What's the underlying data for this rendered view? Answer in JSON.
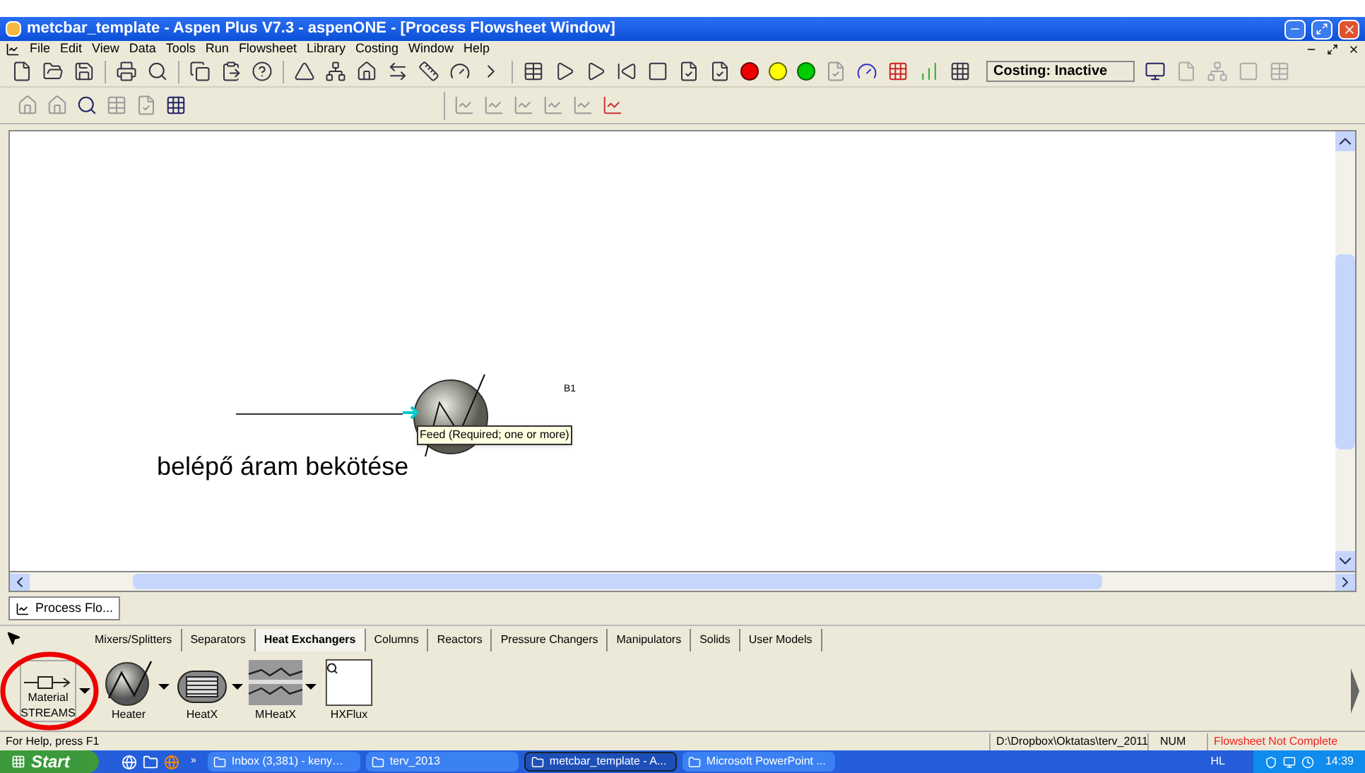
{
  "window": {
    "title": "metcbar_template - Aspen Plus V7.3 - aspenONE - [Process Flowsheet Window]"
  },
  "menu": [
    "File",
    "Edit",
    "View",
    "Data",
    "Tools",
    "Run",
    "Flowsheet",
    "Library",
    "Costing",
    "Window",
    "Help"
  ],
  "toolbar": {
    "costing_status": "Costing: Inactive"
  },
  "flowsheet": {
    "block_label": "B1",
    "tooltip": "Feed (Required; one or more)",
    "annotation": "belépő áram bekötése"
  },
  "document_tabs": [
    {
      "label": "Process Flo...",
      "selected": true
    }
  ],
  "palette_tabs": [
    {
      "label": "Mixers/Splitters",
      "selected": false
    },
    {
      "label": "Separators",
      "selected": false
    },
    {
      "label": "Heat Exchangers",
      "selected": true
    },
    {
      "label": "Columns",
      "selected": false
    },
    {
      "label": "Reactors",
      "selected": false
    },
    {
      "label": "Pressure Changers",
      "selected": false
    },
    {
      "label": "Manipulators",
      "selected": false
    },
    {
      "label": "Solids",
      "selected": false
    },
    {
      "label": "User Models",
      "selected": false
    }
  ],
  "streams_button": {
    "line1": "Material",
    "line2": "STREAMS"
  },
  "models": [
    {
      "kind": "heater",
      "label": "Heater"
    },
    {
      "kind": "heatx",
      "label": "HeatX"
    },
    {
      "kind": "mheatx",
      "label": "MHeatX"
    },
    {
      "kind": "hxflux",
      "label": "HXFlux"
    }
  ],
  "status_bar": {
    "help": "For Help, press F1",
    "path": "D:\\Dropbox\\Oktatas\\terv_2011",
    "num": "NUM",
    "flowsheet_status": "Flowsheet Not Complete"
  },
  "taskbar": {
    "start": "Start",
    "chevron": "»",
    "tasks": [
      {
        "label": "Inbox (3,381) - keny…",
        "selected": false
      },
      {
        "label": "terv_2013",
        "selected": false
      },
      {
        "label": "metcbar_template - A...",
        "selected": true
      },
      {
        "label": "Microsoft PowerPoint ...",
        "selected": false
      }
    ],
    "language": "HL",
    "clock": "14:39"
  }
}
